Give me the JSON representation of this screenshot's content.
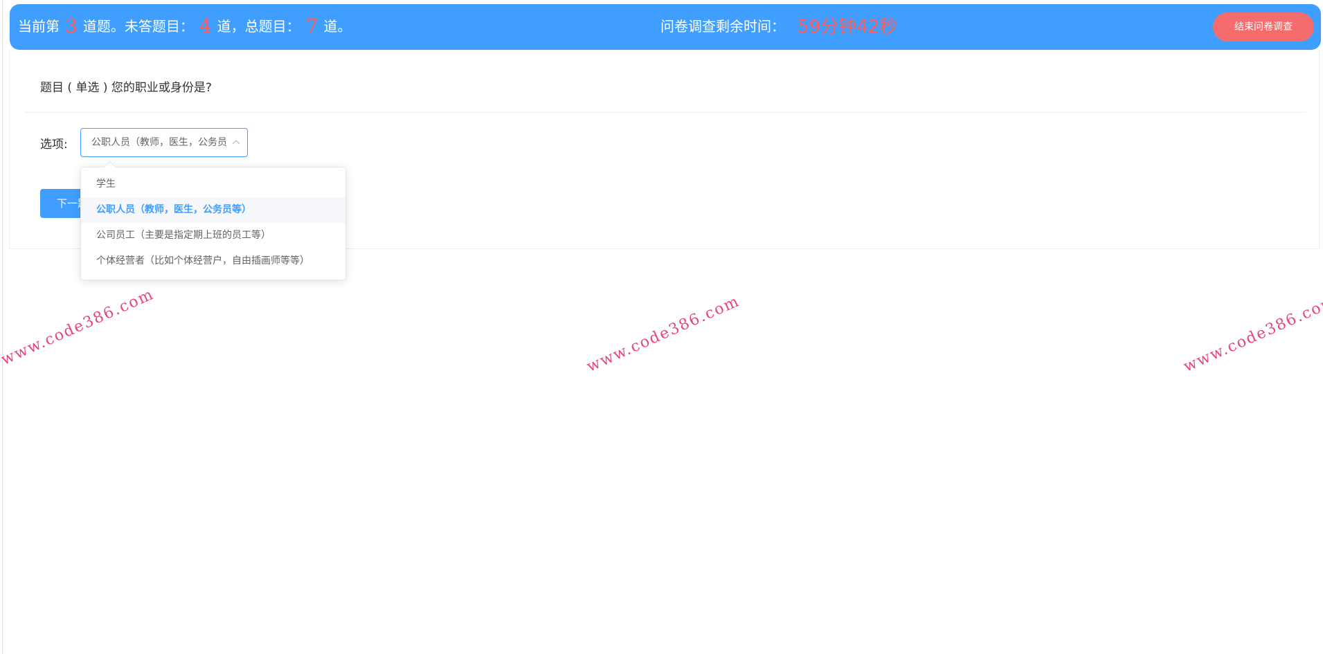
{
  "header": {
    "progress_prefix": "当前第",
    "current_question": "3",
    "progress_mid1": "道题。未答题目：",
    "unanswered_count": "4",
    "progress_mid2": "道，总题目：",
    "total_count": "7",
    "progress_suffix": "道。",
    "timer_label": "问卷调查剩余时间：",
    "timer_value": "59分钟42秒",
    "end_button_label": "结束问卷调查"
  },
  "question": {
    "title": "题目 ( 单选 ) 您的职业或身份是?",
    "options_label": "选项:",
    "selected_value": "公职人员（教师，医生，公务员等）",
    "next_button_label": "下一题"
  },
  "dropdown": {
    "options": [
      {
        "label": "学生"
      },
      {
        "label": "公职人员（教师，医生，公务员等）"
      },
      {
        "label": "公司员工（主要是指定期上班的员工等）"
      },
      {
        "label": "个体经营者（比如个体经营户，自由插画师等等）"
      }
    ],
    "selected_index": 1
  },
  "watermark": {
    "text": "www.code386.com"
  },
  "colors": {
    "primary": "#409eff",
    "danger": "#f56c6c",
    "highlight_number": "#ff5a5a",
    "watermark": "#e8457a"
  }
}
